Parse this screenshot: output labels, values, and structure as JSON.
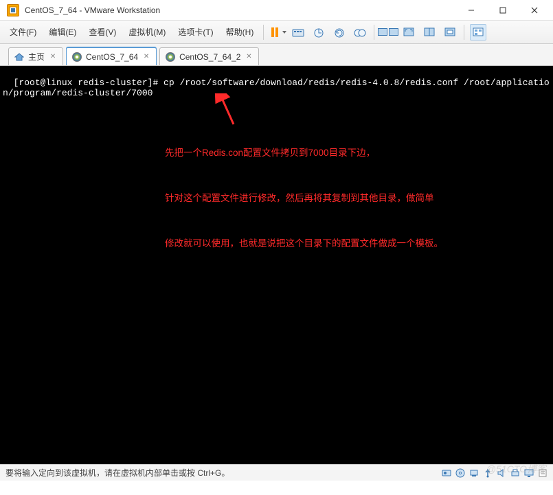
{
  "titlebar": {
    "title": "CentOS_7_64 - VMware Workstation"
  },
  "menu": {
    "file": "文件(F)",
    "edit": "编辑(E)",
    "view": "查看(V)",
    "vm": "虚拟机(M)",
    "tabs": "选项卡(T)",
    "help": "帮助(H)"
  },
  "tabs": [
    {
      "label": "主页",
      "icon": "home"
    },
    {
      "label": "CentOS_7_64",
      "icon": "disc"
    },
    {
      "label": "CentOS_7_64_2",
      "icon": "disc"
    }
  ],
  "terminal": {
    "prompt": "[root@linux redis-cluster]# ",
    "command": "cp /root/software/download/redis/redis-4.0.8/redis.conf /root/application/program/redis-cluster/7000"
  },
  "annotation": {
    "line1": "先把一个Redis.con配置文件拷贝到7000目录下边，",
    "line2": "针对这个配置文件进行修改，然后再将其复制到其他目录，做简单",
    "line3": "修改就可以使用，也就是说把这个目录下的配置文件做成一个模板。"
  },
  "statusbar": {
    "hint": "要将输入定向到该虚拟机，请在虚拟机内部单击或按 Ctrl+G。"
  },
  "watermark": "@51CTO博客",
  "colors": {
    "accent": "#5a9bd5",
    "annotation_red": "#ff2a2a",
    "pause_orange": "#ff9300"
  }
}
